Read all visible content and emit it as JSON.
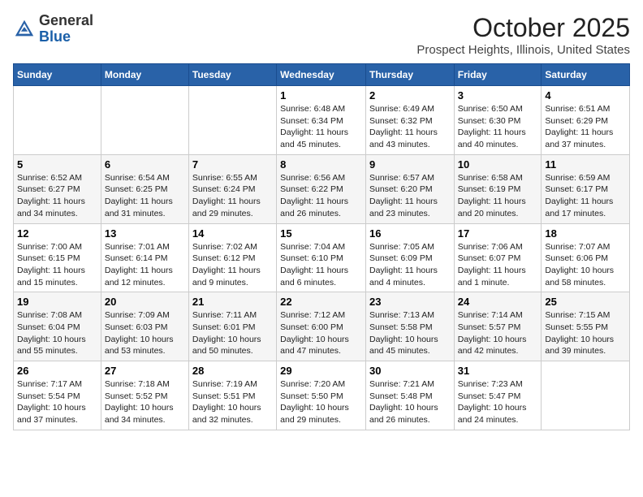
{
  "header": {
    "logo_general": "General",
    "logo_blue": "Blue",
    "month_title": "October 2025",
    "location": "Prospect Heights, Illinois, United States"
  },
  "days_of_week": [
    "Sunday",
    "Monday",
    "Tuesday",
    "Wednesday",
    "Thursday",
    "Friday",
    "Saturday"
  ],
  "weeks": [
    [
      {
        "day": "",
        "info": ""
      },
      {
        "day": "",
        "info": ""
      },
      {
        "day": "",
        "info": ""
      },
      {
        "day": "1",
        "info": "Sunrise: 6:48 AM\nSunset: 6:34 PM\nDaylight: 11 hours and 45 minutes."
      },
      {
        "day": "2",
        "info": "Sunrise: 6:49 AM\nSunset: 6:32 PM\nDaylight: 11 hours and 43 minutes."
      },
      {
        "day": "3",
        "info": "Sunrise: 6:50 AM\nSunset: 6:30 PM\nDaylight: 11 hours and 40 minutes."
      },
      {
        "day": "4",
        "info": "Sunrise: 6:51 AM\nSunset: 6:29 PM\nDaylight: 11 hours and 37 minutes."
      }
    ],
    [
      {
        "day": "5",
        "info": "Sunrise: 6:52 AM\nSunset: 6:27 PM\nDaylight: 11 hours and 34 minutes."
      },
      {
        "day": "6",
        "info": "Sunrise: 6:54 AM\nSunset: 6:25 PM\nDaylight: 11 hours and 31 minutes."
      },
      {
        "day": "7",
        "info": "Sunrise: 6:55 AM\nSunset: 6:24 PM\nDaylight: 11 hours and 29 minutes."
      },
      {
        "day": "8",
        "info": "Sunrise: 6:56 AM\nSunset: 6:22 PM\nDaylight: 11 hours and 26 minutes."
      },
      {
        "day": "9",
        "info": "Sunrise: 6:57 AM\nSunset: 6:20 PM\nDaylight: 11 hours and 23 minutes."
      },
      {
        "day": "10",
        "info": "Sunrise: 6:58 AM\nSunset: 6:19 PM\nDaylight: 11 hours and 20 minutes."
      },
      {
        "day": "11",
        "info": "Sunrise: 6:59 AM\nSunset: 6:17 PM\nDaylight: 11 hours and 17 minutes."
      }
    ],
    [
      {
        "day": "12",
        "info": "Sunrise: 7:00 AM\nSunset: 6:15 PM\nDaylight: 11 hours and 15 minutes."
      },
      {
        "day": "13",
        "info": "Sunrise: 7:01 AM\nSunset: 6:14 PM\nDaylight: 11 hours and 12 minutes."
      },
      {
        "day": "14",
        "info": "Sunrise: 7:02 AM\nSunset: 6:12 PM\nDaylight: 11 hours and 9 minutes."
      },
      {
        "day": "15",
        "info": "Sunrise: 7:04 AM\nSunset: 6:10 PM\nDaylight: 11 hours and 6 minutes."
      },
      {
        "day": "16",
        "info": "Sunrise: 7:05 AM\nSunset: 6:09 PM\nDaylight: 11 hours and 4 minutes."
      },
      {
        "day": "17",
        "info": "Sunrise: 7:06 AM\nSunset: 6:07 PM\nDaylight: 11 hours and 1 minute."
      },
      {
        "day": "18",
        "info": "Sunrise: 7:07 AM\nSunset: 6:06 PM\nDaylight: 10 hours and 58 minutes."
      }
    ],
    [
      {
        "day": "19",
        "info": "Sunrise: 7:08 AM\nSunset: 6:04 PM\nDaylight: 10 hours and 55 minutes."
      },
      {
        "day": "20",
        "info": "Sunrise: 7:09 AM\nSunset: 6:03 PM\nDaylight: 10 hours and 53 minutes."
      },
      {
        "day": "21",
        "info": "Sunrise: 7:11 AM\nSunset: 6:01 PM\nDaylight: 10 hours and 50 minutes."
      },
      {
        "day": "22",
        "info": "Sunrise: 7:12 AM\nSunset: 6:00 PM\nDaylight: 10 hours and 47 minutes."
      },
      {
        "day": "23",
        "info": "Sunrise: 7:13 AM\nSunset: 5:58 PM\nDaylight: 10 hours and 45 minutes."
      },
      {
        "day": "24",
        "info": "Sunrise: 7:14 AM\nSunset: 5:57 PM\nDaylight: 10 hours and 42 minutes."
      },
      {
        "day": "25",
        "info": "Sunrise: 7:15 AM\nSunset: 5:55 PM\nDaylight: 10 hours and 39 minutes."
      }
    ],
    [
      {
        "day": "26",
        "info": "Sunrise: 7:17 AM\nSunset: 5:54 PM\nDaylight: 10 hours and 37 minutes."
      },
      {
        "day": "27",
        "info": "Sunrise: 7:18 AM\nSunset: 5:52 PM\nDaylight: 10 hours and 34 minutes."
      },
      {
        "day": "28",
        "info": "Sunrise: 7:19 AM\nSunset: 5:51 PM\nDaylight: 10 hours and 32 minutes."
      },
      {
        "day": "29",
        "info": "Sunrise: 7:20 AM\nSunset: 5:50 PM\nDaylight: 10 hours and 29 minutes."
      },
      {
        "day": "30",
        "info": "Sunrise: 7:21 AM\nSunset: 5:48 PM\nDaylight: 10 hours and 26 minutes."
      },
      {
        "day": "31",
        "info": "Sunrise: 7:23 AM\nSunset: 5:47 PM\nDaylight: 10 hours and 24 minutes."
      },
      {
        "day": "",
        "info": ""
      }
    ]
  ]
}
